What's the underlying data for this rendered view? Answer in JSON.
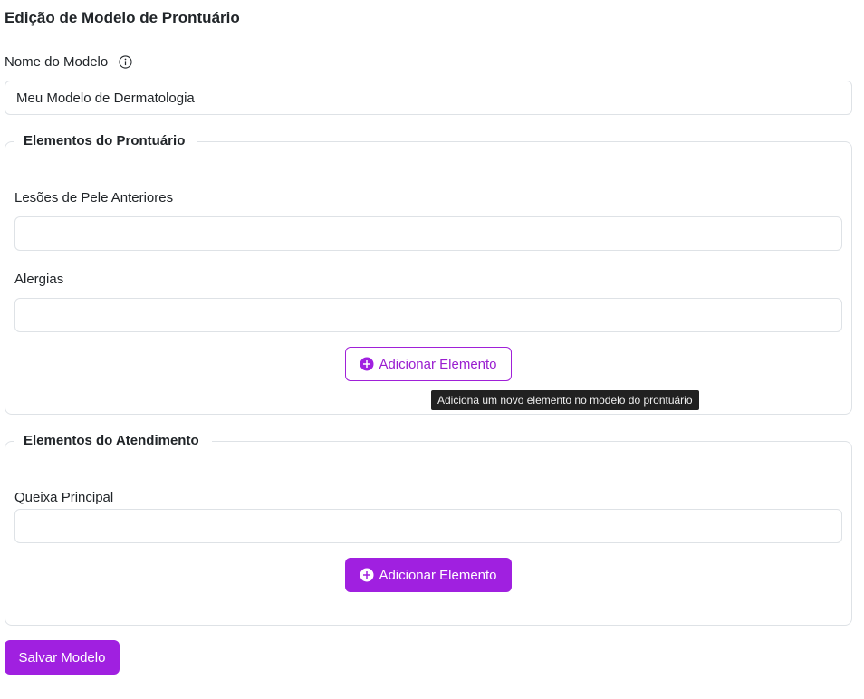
{
  "page": {
    "title": "Edição de Modelo de Prontuário"
  },
  "model_name": {
    "label": "Nome do Modelo",
    "info_icon": "info-circle-icon",
    "value": "Meu Modelo de Dermatologia"
  },
  "prontuario_section": {
    "legend": "Elementos do Prontuário",
    "fields": [
      {
        "label": "Lesões de Pele Anteriores",
        "value": ""
      },
      {
        "label": "Alergias",
        "value": ""
      }
    ],
    "add_button": {
      "label": "Adicionar Elemento",
      "icon": "plus-circle-icon"
    },
    "tooltip": "Adiciona um novo elemento no modelo do prontuário"
  },
  "atendimento_section": {
    "legend": "Elementos do Atendimento",
    "fields": [
      {
        "label": "Queixa Principal",
        "value": ""
      }
    ],
    "add_button": {
      "label": "Adicionar Elemento",
      "icon": "plus-circle-icon"
    }
  },
  "save_button": {
    "label": "Salvar Modelo"
  },
  "colors": {
    "accent": "#a020e0",
    "border": "#dee2e6",
    "tooltip_bg": "#212121"
  }
}
